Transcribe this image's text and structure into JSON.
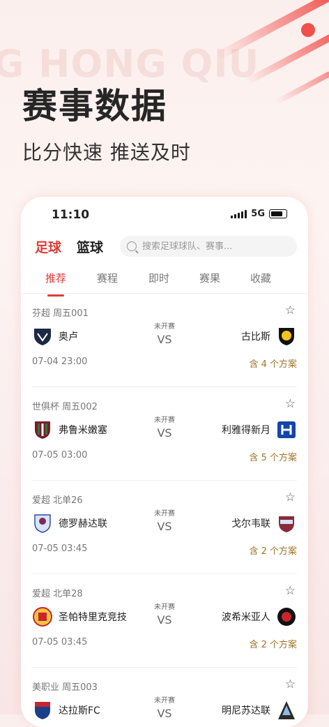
{
  "hero": {
    "bg_text": "G HONG QIU",
    "title": "赛事数据",
    "subtitle": "比分快速  推送及时"
  },
  "status_bar": {
    "time": "11:10",
    "network": "5G"
  },
  "sport_tabs": [
    "足球",
    "篮球"
  ],
  "search": {
    "placeholder": "搜索足球球队、赛事..."
  },
  "sub_tabs": [
    "推荐",
    "赛程",
    "即时",
    "赛果",
    "收藏"
  ],
  "matches": [
    {
      "league": "芬超 周五001",
      "state": "未开赛",
      "vs": "VS",
      "home": "奥卢",
      "away": "古比斯",
      "time": "07-04 23:00",
      "plans": "含 4 个方案"
    },
    {
      "league": "世俱杯 周五002",
      "state": "未开赛",
      "vs": "VS",
      "home": "弗鲁米嫩塞",
      "away": "利雅得新月",
      "time": "07-05 03:00",
      "plans": "含 5 个方案"
    },
    {
      "league": "爱超 北单26",
      "state": "未开赛",
      "vs": "VS",
      "home": "德罗赫达联",
      "away": "戈尔韦联",
      "time": "07-05 03:45",
      "plans": "含 2 个方案"
    },
    {
      "league": "爱超 北单28",
      "state": "未开赛",
      "vs": "VS",
      "home": "圣帕特里克竞技",
      "away": "波希米亚人",
      "time": "07-05 03:45",
      "plans": "含 2 个方案"
    },
    {
      "league": "美职业 周五003",
      "state": "未开赛",
      "vs": "VS",
      "home": "达拉斯FC",
      "away": "明尼苏达联",
      "time": "",
      "plans": ""
    }
  ],
  "colors": {
    "accent": "#e03b37",
    "plan_text": "#a0742a"
  }
}
